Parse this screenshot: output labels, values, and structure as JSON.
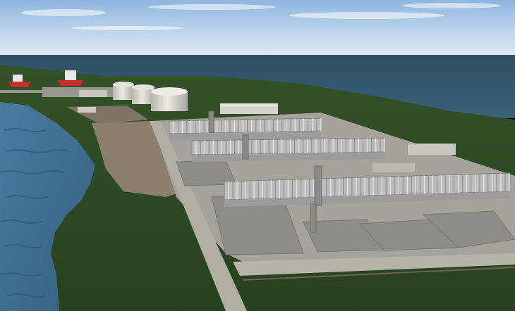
{
  "scene": {
    "subject": "",
    "colors": {
      "sky_top": "#8fb6df",
      "sky_bottom": "#dfe9f2",
      "sea": "#31556a",
      "river": "#3f6f93",
      "grass": "#2d4a22",
      "grass_light": "#3b5a2a",
      "sand": "#8b7f6d",
      "concrete": "#a7a39c",
      "pad": "#8e8c89",
      "steel": "#c9c9c9",
      "tank": "#d9d6cf",
      "ship_hull": "#c0302b"
    }
  }
}
